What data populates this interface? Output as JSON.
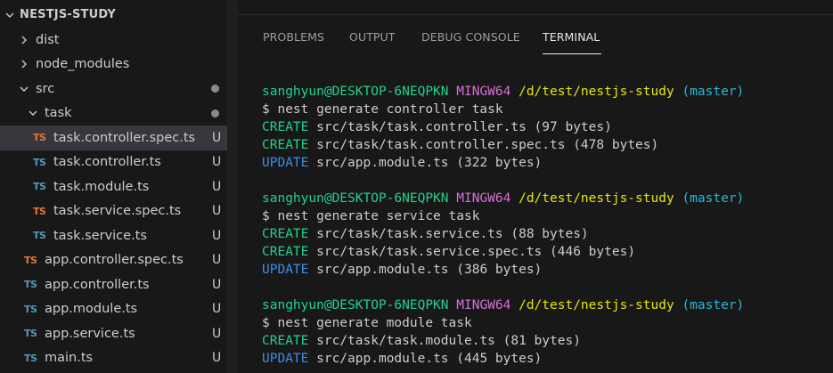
{
  "explorer": {
    "root_label": "NESTJS-STUDY",
    "items": [
      {
        "label": "dist",
        "kind": "folder",
        "expanded": false,
        "status": ""
      },
      {
        "label": "node_modules",
        "kind": "folder",
        "expanded": false,
        "status": ""
      },
      {
        "label": "src",
        "kind": "folder",
        "expanded": true,
        "status": "modified-dot"
      },
      {
        "label": "task",
        "kind": "folder",
        "expanded": true,
        "status": "modified-dot"
      },
      {
        "label": "task.controller.spec.ts",
        "kind": "file",
        "icon_text": "TS",
        "icon_color": "#e37933",
        "status": "U",
        "selected": true
      },
      {
        "label": "task.controller.ts",
        "kind": "file",
        "icon_text": "TS",
        "icon_color": "#519aba",
        "status": "U"
      },
      {
        "label": "task.module.ts",
        "kind": "file",
        "icon_text": "TS",
        "icon_color": "#519aba",
        "status": "U"
      },
      {
        "label": "task.service.spec.ts",
        "kind": "file",
        "icon_text": "TS",
        "icon_color": "#e37933",
        "status": "U"
      },
      {
        "label": "task.service.ts",
        "kind": "file",
        "icon_text": "TS",
        "icon_color": "#519aba",
        "status": "U"
      },
      {
        "label": "app.controller.spec.ts",
        "kind": "file",
        "icon_text": "TS",
        "icon_color": "#e37933",
        "status": "U"
      },
      {
        "label": "app.controller.ts",
        "kind": "file",
        "icon_text": "TS",
        "icon_color": "#519aba",
        "status": "U"
      },
      {
        "label": "app.module.ts",
        "kind": "file",
        "icon_text": "TS",
        "icon_color": "#519aba",
        "status": "U"
      },
      {
        "label": "app.service.ts",
        "kind": "file",
        "icon_text": "TS",
        "icon_color": "#519aba",
        "status": "U"
      },
      {
        "label": "main.ts",
        "kind": "file",
        "icon_text": "TS",
        "icon_color": "#519aba",
        "status": "U"
      }
    ]
  },
  "panel": {
    "tabs": [
      "PROBLEMS",
      "OUTPUT",
      "DEBUG CONSOLE",
      "TERMINAL"
    ],
    "active_tab": "TERMINAL"
  },
  "terminal": {
    "prompt": {
      "user_host": "sanghyun@DESKTOP-6NEQPKN",
      "shell": "MINGW64",
      "path": "/d/test/nestjs-study",
      "branch": "(master)"
    },
    "blocks": [
      {
        "command": "$ nest generate controller task",
        "outputs": [
          {
            "action": "CREATE",
            "text": "src/task/task.controller.ts (97 bytes)"
          },
          {
            "action": "CREATE",
            "text": "src/task/task.controller.spec.ts (478 bytes)"
          },
          {
            "action": "UPDATE",
            "text": "src/app.module.ts (322 bytes)"
          }
        ]
      },
      {
        "command": "$ nest generate service task",
        "outputs": [
          {
            "action": "CREATE",
            "text": "src/task/task.service.ts (88 bytes)"
          },
          {
            "action": "CREATE",
            "text": "src/task/task.service.spec.ts (446 bytes)"
          },
          {
            "action": "UPDATE",
            "text": "src/app.module.ts (386 bytes)"
          }
        ]
      },
      {
        "command": "$ nest generate module task",
        "outputs": [
          {
            "action": "CREATE",
            "text": "src/task/task.module.ts (81 bytes)"
          },
          {
            "action": "UPDATE",
            "text": "src/app.module.ts (445 bytes)"
          }
        ]
      }
    ]
  },
  "colors": {
    "user_host": "#23d18b",
    "shell": "#d670d6",
    "path": "#e5e510",
    "branch": "#29b8db",
    "create": "#23d18b",
    "update": "#3b8eea",
    "ts_blue": "#519aba",
    "ts_orange": "#e37933"
  }
}
